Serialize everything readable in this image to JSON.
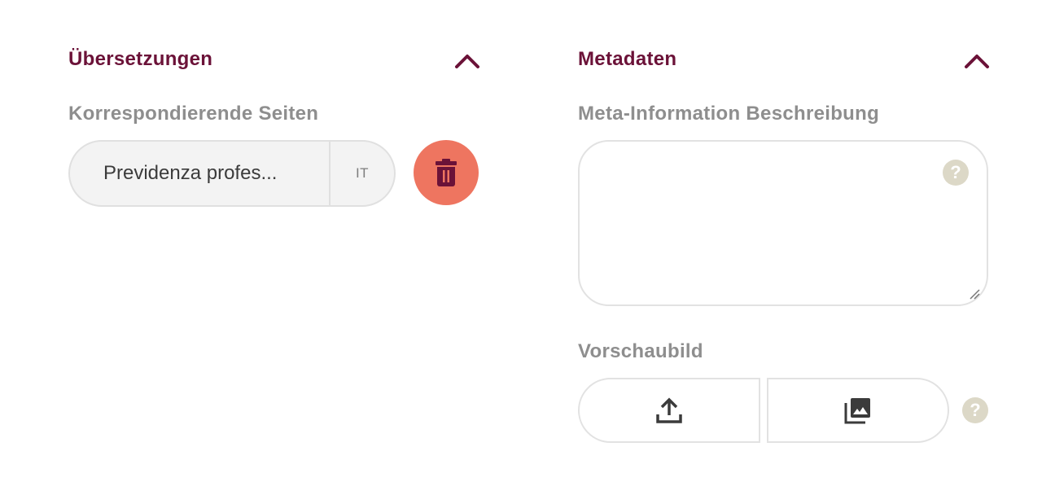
{
  "translations": {
    "title": "Übersetzungen",
    "toggle_icon": "chevron-up-icon",
    "label": "Korrespondierende Seiten",
    "pages": [
      {
        "title": "Previdenza profes...",
        "lang": "IT",
        "delete_icon": "trash-icon"
      }
    ]
  },
  "metadata": {
    "title": "Metadaten",
    "toggle_icon": "chevron-up-icon",
    "description": {
      "label": "Meta-Information Beschreibung",
      "value": "",
      "help": "?"
    },
    "preview": {
      "label": "Vorschaubild",
      "upload_icon": "upload-icon",
      "library_icon": "image-library-icon",
      "help": "?"
    }
  },
  "colors": {
    "accent": "#6b1238",
    "label": "#8e8e8e",
    "danger": "#ee7560",
    "help": "#dcd8c7"
  }
}
